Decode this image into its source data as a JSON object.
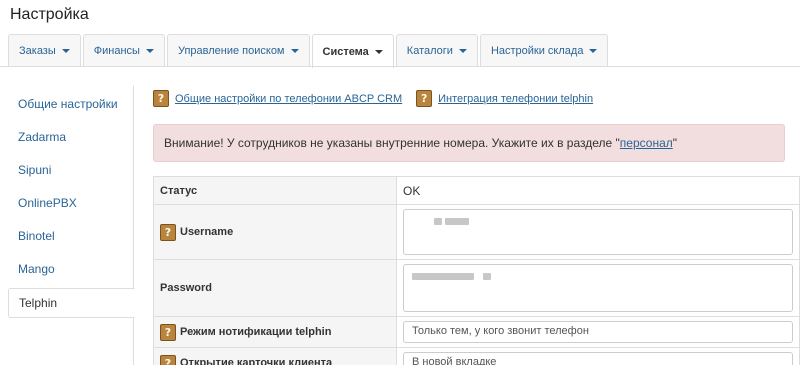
{
  "page": {
    "title": "Настройка"
  },
  "tabs": [
    {
      "label": "Заказы",
      "dropdown": true
    },
    {
      "label": "Финансы",
      "dropdown": true
    },
    {
      "label": "Управление поиском",
      "dropdown": true
    },
    {
      "label": "Система",
      "dropdown": true,
      "active": true
    },
    {
      "label": "Каталоги",
      "dropdown": true
    },
    {
      "label": "Настройки склада",
      "dropdown": true
    }
  ],
  "sidebar": {
    "items": [
      {
        "label": "Общие настройки"
      },
      {
        "label": "Zadarma"
      },
      {
        "label": "Sipuni"
      },
      {
        "label": "OnlinePBX"
      },
      {
        "label": "Binotel"
      },
      {
        "label": "Mango"
      },
      {
        "label": "Telphin",
        "active": true
      }
    ]
  },
  "help_links": [
    {
      "label": "Общие настройки по телефонии ABCP CRM",
      "icon": "help-book-icon"
    },
    {
      "label": "Интеграция телефонии telphin",
      "icon": "help-book-icon"
    }
  ],
  "alert": {
    "text_before": "Внимание! У сотрудников не указаны внутренние номера. Укажите их в разделе \"",
    "link": "персонал",
    "text_after": "\""
  },
  "settings": {
    "status": {
      "label": "Статус",
      "value": "OK"
    },
    "username": {
      "label": "Username",
      "value": ""
    },
    "password": {
      "label": "Password",
      "value": ""
    },
    "notify_mode": {
      "label": "Режим нотификации telphin",
      "value": "Только тем, у кого звонит телефон"
    },
    "open_card": {
      "label": "Открытие карточки клиента",
      "value": "В новой вкладке"
    }
  },
  "colors": {
    "link": "#2a6496",
    "alert_bg": "#f2dede",
    "label_bg": "#f5f5f5"
  }
}
